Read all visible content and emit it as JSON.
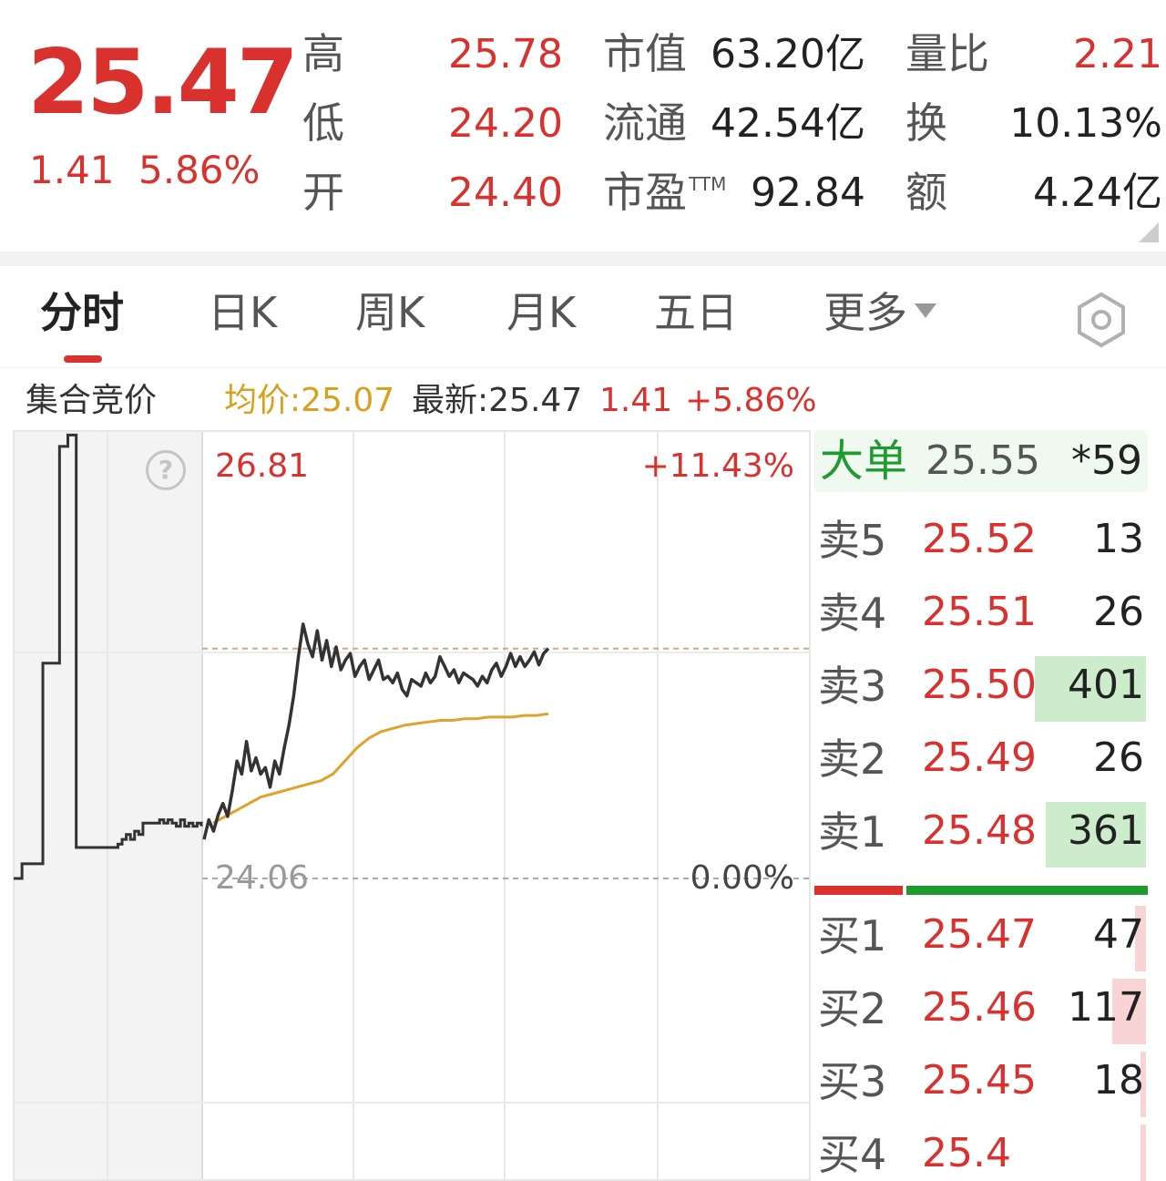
{
  "quote": {
    "price": "25.47",
    "change": "1.41",
    "change_pct": "5.86%"
  },
  "stats": {
    "high_label": "高",
    "high": "25.78",
    "low_label": "低",
    "low": "24.20",
    "open_label": "开",
    "open": "24.40",
    "mcap_label": "市值",
    "mcap": "63.20亿",
    "float_label": "流通",
    "float": "42.54亿",
    "pe_label": "市盈",
    "pe_sup": "TTM",
    "pe": "92.84",
    "vol_ratio_label": "量比",
    "vol_ratio": "2.21",
    "turnover_label": "换",
    "turnover": "10.13%",
    "amount_label": "额",
    "amount": "4.24亿"
  },
  "tabs": {
    "intraday": "分时",
    "daily": "日K",
    "weekly": "周K",
    "monthly": "月K",
    "five_day": "五日",
    "more": "更多"
  },
  "info": {
    "auction": "集合竞价",
    "avg": "均价:25.07",
    "latest": "最新:25.47",
    "change": "1.41",
    "pct": "+5.86%"
  },
  "chart_data": {
    "type": "line",
    "y_top_label": "26.81",
    "y_base_label": "24.06",
    "pct_top_label": "+11.43%",
    "pct_base_label": "0.00%",
    "ylim": [
      24.06,
      26.81
    ],
    "prev_close": 24.06,
    "reference_line": 25.47,
    "auction_series": [
      24.06,
      24.06,
      24.15,
      24.15,
      24.15,
      24.15,
      24.15,
      25.38,
      25.38,
      25.38,
      25.38,
      26.71,
      26.71,
      26.78,
      26.78,
      24.25,
      24.25,
      24.25,
      24.25,
      24.25,
      24.25,
      24.25,
      24.25,
      24.25,
      24.25,
      24.27,
      24.3,
      24.33,
      24.3,
      24.35,
      24.33,
      24.4,
      24.4,
      24.4,
      24.4,
      24.42,
      24.4,
      24.42,
      24.4,
      24.38,
      24.42,
      24.38,
      24.4,
      24.38,
      24.4,
      24.38
    ],
    "series": [
      {
        "name": "最新",
        "values": [
          24.3,
          24.42,
          24.35,
          24.45,
          24.52,
          24.44,
          24.6,
          24.78,
          24.7,
          24.9,
          24.72,
          24.8,
          24.7,
          24.74,
          24.62,
          24.78,
          24.7,
          24.86,
          25.0,
          25.18,
          25.42,
          25.62,
          25.5,
          25.42,
          25.58,
          25.4,
          25.52,
          25.36,
          25.48,
          25.34,
          25.4,
          25.44,
          25.3,
          25.36,
          25.4,
          25.28,
          25.34,
          25.4,
          25.28,
          25.3,
          25.26,
          25.32,
          25.22,
          25.18,
          25.28,
          25.26,
          25.24,
          25.32,
          25.26,
          25.3,
          25.42,
          25.36,
          25.3,
          25.34,
          25.26,
          25.32,
          25.3,
          25.28,
          25.24,
          25.3,
          25.26,
          25.34,
          25.38,
          25.3,
          25.36,
          25.44,
          25.36,
          25.42,
          25.36,
          25.4,
          25.45,
          25.37,
          25.44,
          25.47
        ]
      },
      {
        "name": "均价",
        "values": [
          24.4,
          24.44,
          24.48,
          24.52,
          24.56,
          24.58,
          24.6,
          24.62,
          24.64,
          24.66,
          24.7,
          24.78,
          24.86,
          24.92,
          24.96,
          24.98,
          25.0,
          25.01,
          25.02,
          25.03,
          25.03,
          25.04,
          25.04,
          25.05,
          25.05,
          25.05,
          25.06,
          25.06,
          25.07
        ]
      }
    ]
  },
  "order_book": {
    "big_order": {
      "label": "大单",
      "price": "25.55",
      "volume": "*59"
    },
    "sells": [
      {
        "label": "卖5",
        "price": "25.52",
        "volume": "13",
        "bar": 0
      },
      {
        "label": "卖4",
        "price": "25.51",
        "volume": "26",
        "bar": 0
      },
      {
        "label": "卖3",
        "price": "25.50",
        "volume": "401",
        "bar": 1.0
      },
      {
        "label": "卖2",
        "price": "25.49",
        "volume": "26",
        "bar": 0
      },
      {
        "label": "卖1",
        "price": "25.48",
        "volume": "361",
        "bar": 0.9
      }
    ],
    "buys": [
      {
        "label": "买1",
        "price": "25.47",
        "volume": "47",
        "bar": 0.1
      },
      {
        "label": "买2",
        "price": "25.46",
        "volume": "117",
        "bar": 0.3
      },
      {
        "label": "买3",
        "price": "25.45",
        "volume": "18",
        "bar": 0.05
      },
      {
        "label": "买4",
        "price": "25.4",
        "volume": "",
        "bar": 0.05
      }
    ],
    "buy_sell_ratio": 0.27,
    "colors": {
      "red": "#d9312d",
      "green": "#1e9a2f",
      "avg_line": "#e0a22a"
    }
  }
}
